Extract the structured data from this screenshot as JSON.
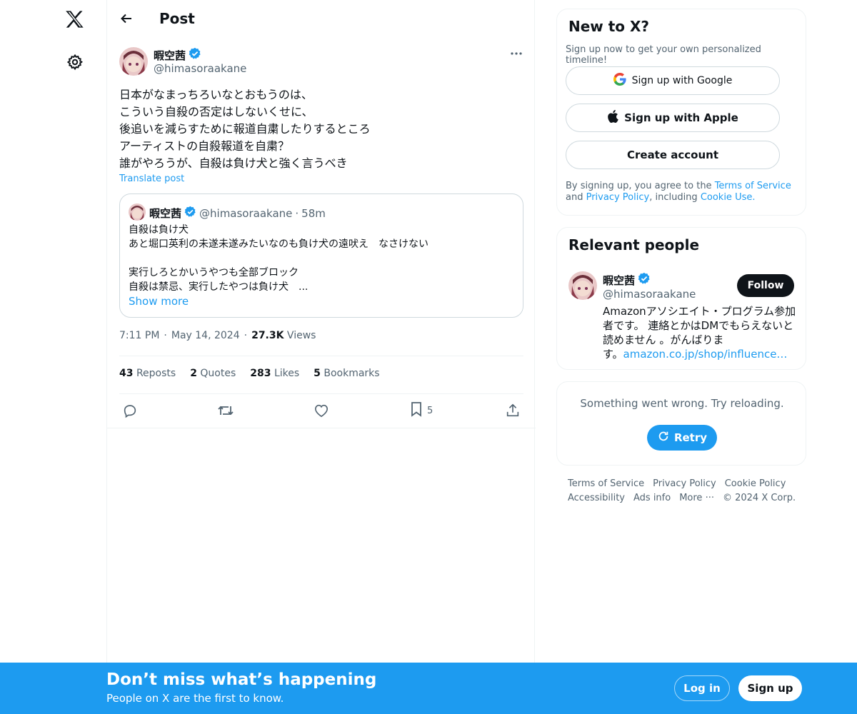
{
  "header": {
    "title": "Post"
  },
  "post": {
    "author_name": "暇空茜",
    "author_handle": "@himasoraakane",
    "text_lines": [
      "日本がなまっちろいなとおもうのは、",
      "こういう自殺の否定はしないくせに、",
      "後追いを減らすために報道自粛したりするところ",
      "アーティストの自殺報道を自粛？",
      "誰がやろうが、自殺は負け犬と強く言うべき"
    ],
    "translate_label": "Translate post",
    "quote": {
      "author_name": "暇空茜",
      "author_handle": "@himasoraakane",
      "separator": "·",
      "time": "58m",
      "text_lines": [
        "自殺は負け犬",
        "あと堀口英利の未遂未遂みたいなのも負け犬の遠吠え　なさけない",
        "",
        "実行しろとかいうやつも全部ブロック",
        "自殺は禁忌、実行したやつは負け犬　..."
      ],
      "show_more": "Show more"
    },
    "time": "7:11 PM",
    "date": "May 14, 2024",
    "separator": "·",
    "views_count": "27.3K",
    "views_label": "Views",
    "stats": {
      "reposts_count": "43",
      "reposts_label": "Reposts",
      "quotes_count": "2",
      "quotes_label": "Quotes",
      "likes_count": "283",
      "likes_label": "Likes",
      "bookmarks_count": "5",
      "bookmarks_label": "Bookmarks"
    },
    "actions": {
      "bookmark_count": "5"
    }
  },
  "signup_card": {
    "title": "New to X?",
    "subtitle": "Sign up now to get your own personalized timeline!",
    "google_label": "Sign up with Google",
    "apple_label": "Sign up with Apple",
    "create_label": "Create account",
    "legal_1": "By signing up, you agree to the ",
    "terms": "Terms of Service",
    "legal_2": " and ",
    "privacy": "Privacy Policy",
    "legal_3": ", including ",
    "cookie": "Cookie Use."
  },
  "relevant_people": {
    "title": "Relevant people",
    "name": "暇空茜",
    "handle": "@himasoraakane",
    "follow_label": "Follow",
    "bio_lines": [
      "Amazonアソシエイト・プログラム参加",
      "者です。 連絡とかはDMでもらえないと",
      "読めません 。がんばりま"
    ],
    "bio_last_prefix": "す。",
    "bio_link": "amazon.co.jp/shop/influence…"
  },
  "error_card": {
    "message": "Something went wrong. Try reloading.",
    "retry_label": "Retry"
  },
  "footer": {
    "links": [
      "Terms of Service",
      "Privacy Policy",
      "Cookie Policy",
      "Accessibility",
      "Ads info",
      "More ···",
      "© 2024 X Corp."
    ]
  },
  "bottom_bar": {
    "title": "Don’t miss what’s happening",
    "subtitle": "People on X are the first to know.",
    "login_label": "Log in",
    "signup_label": "Sign up"
  },
  "colors": {
    "accent": "#1d9bf0",
    "text": "#0f1419",
    "muted": "#536471",
    "border": "#cfd9de"
  }
}
